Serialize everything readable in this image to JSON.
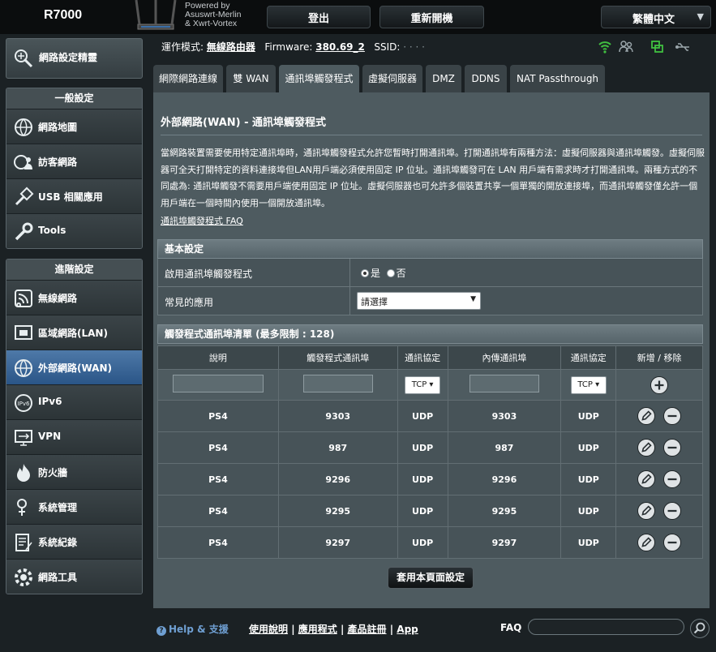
{
  "header": {
    "model": "R7000",
    "powered_line1": "Powered by",
    "powered_line2": "Asuswrt-Merlin",
    "powered_line3": "& Xwrt-Vortex",
    "logout_label": "登出",
    "reboot_label": "重新開機",
    "language_label": "繁體中文"
  },
  "status": {
    "mode_label": "運作模式:",
    "mode_value": "無線路由器",
    "firmware_label": "Firmware:",
    "firmware_value": "380.69_2",
    "ssid_label": "SSID:"
  },
  "sidebar": {
    "qis_label": "網路設定精靈",
    "general_header": "一般設定",
    "general_items": [
      {
        "label": "網路地圖",
        "icon": "network-map-icon"
      },
      {
        "label": "訪客網路",
        "icon": "guest-network-icon"
      },
      {
        "label": "USB 相關應用",
        "icon": "usb-icon"
      },
      {
        "label": "Tools",
        "icon": "wrench-icon"
      }
    ],
    "advanced_header": "進階設定",
    "advanced_items": [
      {
        "label": "無線網路",
        "icon": "wireless-icon"
      },
      {
        "label": "區域網路(LAN)",
        "icon": "lan-icon"
      },
      {
        "label": "外部網路(WAN)",
        "icon": "wan-globe-icon"
      },
      {
        "label": "IPv6",
        "icon": "ipv6-icon"
      },
      {
        "label": "VPN",
        "icon": "vpn-icon"
      },
      {
        "label": "防火牆",
        "icon": "firewall-icon"
      },
      {
        "label": "系統管理",
        "icon": "administration-icon"
      },
      {
        "label": "系統紀錄",
        "icon": "system-log-icon"
      },
      {
        "label": "網路工具",
        "icon": "network-tools-icon"
      }
    ]
  },
  "tabs": [
    "網際網路連線",
    "雙 WAN",
    "通訊埠觸發程式",
    "虛擬伺服器",
    "DMZ",
    "DDNS",
    "NAT Passthrough"
  ],
  "main": {
    "title": "外部網路(WAN) - 通訊埠觸發程式",
    "description": "當網路裝置需要使用特定通訊埠時，通訊埠觸發程式允許您暫時打開通訊埠。打開通訊埠有兩種方法：虛擬伺服器與通訊埠觸發。虛擬伺服器可全天打開特定的資料連接埠但LAN用戶端必須使用固定 IP 位址。通訊埠觸發可在 LAN 用戶端有需求時才打開通訊埠。兩種方式的不同處為: 通訊埠觸發不需要用戶端使用固定 IP 位址。虛擬伺服器也可允許多個裝置共享一個單獨的開放連接埠，而通訊埠觸發僅允許一個用戶端在一個時間內使用一個開放通訊埠。",
    "faq_link": "通訊埠觸發程式 FAQ",
    "basic_header": "基本設定",
    "enable_label": "啟用通訊埠觸發程式",
    "yes_label": "是",
    "no_label": "否",
    "enable_value": "yes",
    "well_known_label": "常見的應用",
    "well_known_value": "請選擇",
    "list_header": "觸發程式通訊埠清單 (最多限制 : 128)",
    "columns": [
      "說明",
      "觸發程式通訊埠",
      "通訊協定",
      "內傳通訊埠",
      "通訊協定",
      "新增 / 移除"
    ],
    "default_protocol": "TCP",
    "rows": [
      {
        "desc": "PS4",
        "trigger_port": "9303",
        "trigger_proto": "UDP",
        "incoming_port": "9303",
        "incoming_proto": "UDP"
      },
      {
        "desc": "PS4",
        "trigger_port": "987",
        "trigger_proto": "UDP",
        "incoming_port": "987",
        "incoming_proto": "UDP"
      },
      {
        "desc": "PS4",
        "trigger_port": "9296",
        "trigger_proto": "UDP",
        "incoming_port": "9296",
        "incoming_proto": "UDP"
      },
      {
        "desc": "PS4",
        "trigger_port": "9295",
        "trigger_proto": "UDP",
        "incoming_port": "9295",
        "incoming_proto": "UDP"
      },
      {
        "desc": "PS4",
        "trigger_port": "9297",
        "trigger_proto": "UDP",
        "incoming_port": "9297",
        "incoming_proto": "UDP"
      }
    ],
    "apply_label": "套用本頁面設定"
  },
  "footer": {
    "help_label": "Help & 支援",
    "manual_label": "使用說明",
    "utility_label": "應用程式",
    "registration_label": "產品註冊",
    "app_label": "App",
    "faq_label": "FAQ"
  },
  "colors": {
    "background": "#1b2124",
    "panel": "#4e5b60",
    "active_nav": "#3d6a9c",
    "wifi_green": "#40c040",
    "help_blue": "#6f9fd2"
  }
}
